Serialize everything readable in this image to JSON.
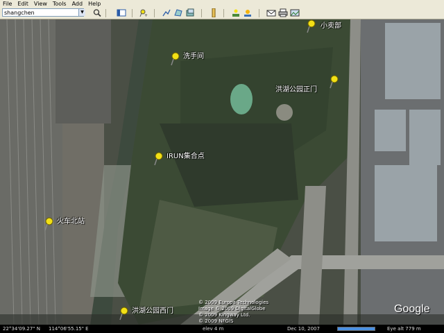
{
  "menu": {
    "items": [
      "File",
      "Edit",
      "View",
      "Tools",
      "Add",
      "Help"
    ]
  },
  "search": {
    "value": "shangchen"
  },
  "toolbar": {
    "icons": [
      "search-icon",
      "sidebar-icon",
      "placemark-icon",
      "path-icon",
      "polygon-icon",
      "overlay-icon",
      "ruler-icon",
      "sky-icon",
      "sun-icon",
      "email-icon",
      "print-icon",
      "image-icon"
    ]
  },
  "map": {
    "places": [
      "小卖部",
      "洗手间",
      "洪湖公园正门",
      "IRUN集合点",
      "火车北站",
      "洪湖公园西门"
    ],
    "copyright": [
      "© 2009 Europa Technologies",
      "Image © 2009 DigitalGlobe",
      "© 2009 Kingway Ltd.",
      "© 2009 NFGIS"
    ],
    "logo": "Google"
  },
  "status": {
    "coords_lat": "22°34'09.27\" N",
    "coords_lon": "114°06'55.15\" E",
    "elev": "elev    4 m",
    "date": "Dec 10, 2007",
    "eye_alt": "Eye alt    779 m"
  },
  "colors": {
    "pin": "#f2e016",
    "toolbar_bg": "#ece9d8",
    "map_dark": "#3a4434"
  }
}
